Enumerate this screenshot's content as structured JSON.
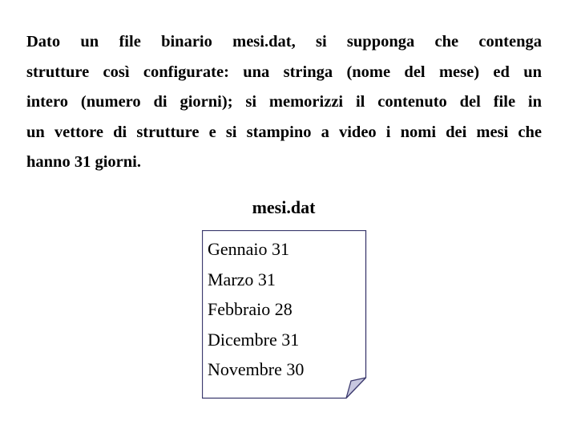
{
  "exercise": {
    "lines": [
      "Dato un file binario mesi.dat, si supponga che contenga",
      "strutture così configurate: una stringa (nome del mese) ed un",
      "intero (numero di giorni); si memorizzi il contenuto del file in",
      "un vettore di strutture e si stampino a video i nomi dei mesi che",
      "hanno 31 giorni."
    ]
  },
  "file": {
    "name": "mesi.dat",
    "icon": "document-page-curl-icon",
    "records": [
      "Gennaio 31",
      "Marzo 31",
      "Febbraio 28",
      "Dicembre 31",
      "Novembre 30"
    ],
    "colors": {
      "border": "#3c3a6e",
      "fold": "#c8c8e0"
    }
  }
}
